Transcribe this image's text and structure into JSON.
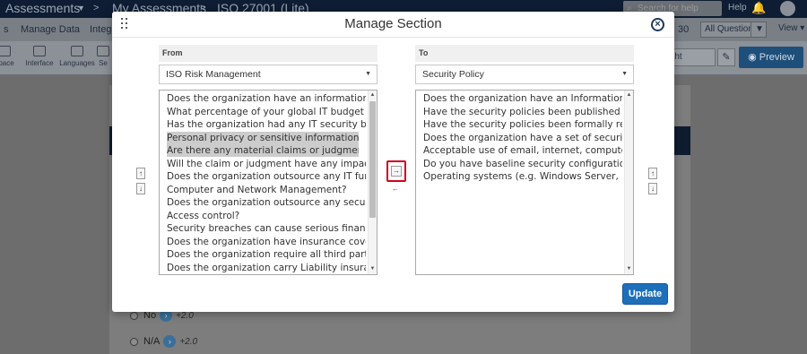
{
  "topbar": {
    "app_title": "Assessments",
    "breadcrumb_1": "My Assessments",
    "breadcrumb_2": "ISO 27001 (Lite)",
    "search_placeholder": "Search for help",
    "help_label": "Help"
  },
  "menubar": {
    "manage_data": "Manage Data",
    "integrations": "Integr",
    "page_number": "30",
    "questions_filter": "All Questions",
    "view_label": "View"
  },
  "toolbar": {
    "tools": [
      "space",
      "Interface",
      "Languages",
      "Se"
    ],
    "field_value": "/Lht",
    "preview_label": "Preview"
  },
  "background_options": [
    {
      "label": "No",
      "score": "+2.0"
    },
    {
      "label": "N/A",
      "score": "+2.0"
    }
  ],
  "modal": {
    "title": "Manage Section",
    "update_label": "Update",
    "from": {
      "header": "From",
      "selected_section": "ISO Risk Management",
      "questions": [
        {
          "text": "Does the organization have an information technology",
          "selected": false
        },
        {
          "text": "What percentage of your global IT budget is allocated",
          "selected": false
        },
        {
          "text": "Has the organization had any IT security breaches",
          "selected": false
        },
        {
          "text": "Personal privacy or sensitive information?",
          "selected": true
        },
        {
          "text": "Are there any material claims or judgments against",
          "selected": true
        },
        {
          "text": "Will the claim or judgment have any impact on the",
          "selected": false
        },
        {
          "text": "Does the organization outsource any IT functions or",
          "selected": false
        },
        {
          "text": "Computer and Network Management?",
          "selected": false
        },
        {
          "text": "Does the organization outsource any security or co",
          "selected": false
        },
        {
          "text": "Access control?",
          "selected": false
        },
        {
          "text": "Security breaches can cause serious financial loss",
          "selected": false
        },
        {
          "text": "Does the organization have insurance coverage pe",
          "selected": false
        },
        {
          "text": "Does the organization require all third parties to c",
          "selected": false
        },
        {
          "text": "Does the organization carry Liability insurance?",
          "selected": false
        }
      ]
    },
    "to": {
      "header": "To",
      "selected_section": "Security Policy",
      "questions": [
        {
          "text": "Does the organization have an Information Securit",
          "selected": false
        },
        {
          "text": "Have the security policies been published and cor",
          "selected": false
        },
        {
          "text": "Have the security policies been formally reviewed",
          "selected": false
        },
        {
          "text": "Does the organization have a set of security polici",
          "selected": false
        },
        {
          "text": "Acceptable use of email, internet, computer syster",
          "selected": false
        },
        {
          "text": "Do you have baseline security configurations for y",
          "selected": false
        },
        {
          "text": "Operating systems (e.g. Windows Server, Unix, Linu",
          "selected": false
        }
      ]
    }
  }
}
